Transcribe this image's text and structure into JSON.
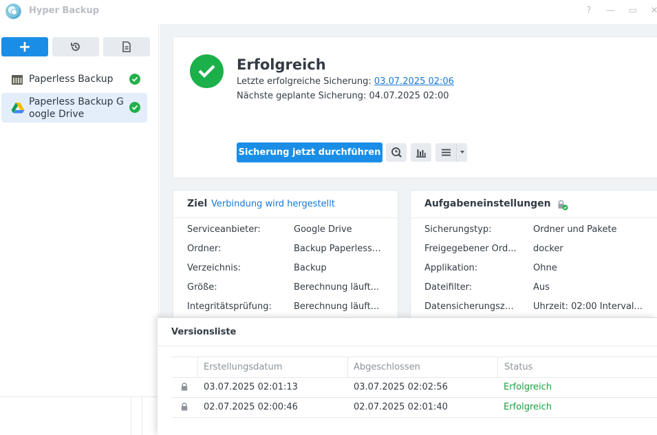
{
  "window": {
    "title": "Hyper Backup",
    "help": "?",
    "minimize": "—",
    "maximize": "▭",
    "close": "✕"
  },
  "toolbar": {
    "add_label": "+"
  },
  "tasks": [
    {
      "label": "Paperless Backup",
      "icon": "nas-icon",
      "status": "ok"
    },
    {
      "label": "Paperless Backup Google Drive",
      "icon": "google-drive-icon",
      "status": "ok",
      "selected": true
    }
  ],
  "status": {
    "title": "Erfolgreich",
    "last_label": "Letzte erfolgreiche Sicherung: ",
    "last_value": "03.07.2025 02:06",
    "next_line": "Nächste geplante Sicherung: 04.07.2025 02:00",
    "backup_button": "Sicherung jetzt durchführen"
  },
  "target": {
    "title": "Ziel",
    "connection": "Verbindung wird hergestellt",
    "rows": [
      {
        "k": "Serviceanbieter:",
        "v": "Google Drive"
      },
      {
        "k": "Ordner:",
        "v": "Backup Paperless ..."
      },
      {
        "k": "Verzeichnis:",
        "v": "Backup"
      },
      {
        "k": "Größe:",
        "v": "Berechnung läuft..."
      },
      {
        "k": "Integritätsprüfung:",
        "v": "Berechnung läuft..."
      }
    ]
  },
  "settings": {
    "title": "Aufgabeneinstellungen",
    "rows": [
      {
        "k": "Sicherungstyp:",
        "v": "Ordner und Pakete"
      },
      {
        "k": "Freigegebener Ord...",
        "v": "docker"
      },
      {
        "k": "Applikation:",
        "v": "Ohne"
      },
      {
        "k": "Dateifilter:",
        "v": "Aus"
      },
      {
        "k": "Datensicherungsze...",
        "v": "Uhrzeit: 02:00 Interval..."
      }
    ]
  },
  "versions": {
    "title": "Versionsliste",
    "columns": [
      "Erstellungsdatum",
      "Abgeschlossen",
      "Status"
    ],
    "rows": [
      {
        "created": "03.07.2025 02:01:13",
        "finished": "03.07.2025 02:02:56",
        "status": "Erfolgreich"
      },
      {
        "created": "02.07.2025 02:00:46",
        "finished": "02.07.2025 02:01:40",
        "status": "Erfolgreich"
      }
    ]
  },
  "colors": {
    "accent": "#1a8ee6",
    "success": "#1cb04a",
    "link": "#1577d6"
  }
}
